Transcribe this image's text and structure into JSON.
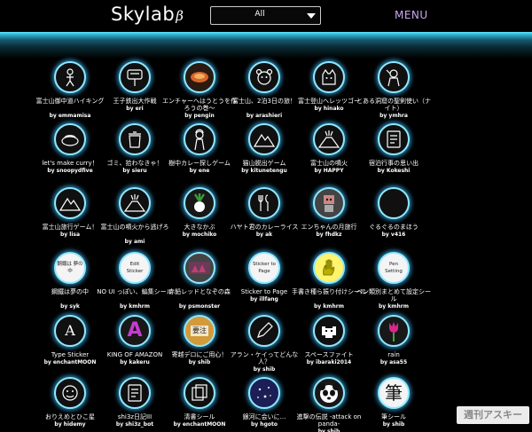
{
  "header": {
    "logo": "Skylab",
    "logo_suffix": "β",
    "filter_value": "All",
    "menu_label": "MENU"
  },
  "stickers": [
    {
      "title": "富士山御中道ハイキング",
      "author": "by emmamisa",
      "icon": "hiker-icon"
    },
    {
      "title": "王子鉄出大作戦",
      "author": "by eri",
      "icon": "sign-icon"
    },
    {
      "title": "エンチャーへはうとうを作ろうの巻～",
      "author": "by pengin",
      "icon": "food-icon"
    },
    {
      "title": "富士山、2泊3日の旅！",
      "author": "by arashieri",
      "icon": "bear-icon"
    },
    {
      "title": "富士登山ヘレッツゴー",
      "author": "by hinako",
      "icon": "cat-icon"
    },
    {
      "title": "とある洞窟の聖剣使い（ナイト）",
      "author": "by ymhra",
      "icon": "knight-icon"
    },
    {
      "title": "let's make curry！",
      "author": "by snoopydfive",
      "icon": "curry-icon"
    },
    {
      "title": "ゴミ、拾わなきゃ！",
      "author": "by sieru",
      "icon": "trash-icon"
    },
    {
      "title": "樹中カレー探しゲーム",
      "author": "by ene",
      "icon": "girl-icon"
    },
    {
      "title": "猫山脱出ゲーム",
      "author": "by kitunetengu",
      "icon": "mountain-icon"
    },
    {
      "title": "富士山の噴火",
      "author": "by HAPPY",
      "icon": "volcano-icon"
    },
    {
      "title": "宿泊行事の思い出",
      "author": "by Kokeshi",
      "icon": "notebook-icon"
    },
    {
      "title": "富士山旅行ゲーム！",
      "author": "by lisa",
      "icon": "mountain-icon"
    },
    {
      "title": "富士山の噴火から逃げろ",
      "author": "by ami",
      "icon": "volcano-icon"
    },
    {
      "title": "大きなかぶ",
      "author": "by mochiko",
      "icon": "turnip-icon"
    },
    {
      "title": "ハヤト君のカレーライス",
      "author": "by ak",
      "icon": "cutlery-icon"
    },
    {
      "title": "エンちゃんの月旅行",
      "author": "by fhdkz",
      "icon": "robot-icon"
    },
    {
      "title": "ぐるぐるのまほう",
      "author": "by v416",
      "icon": "blank-icon"
    },
    {
      "title": "鋼鐵は夢の中",
      "author": "by syk",
      "icon": "text-icon",
      "badge": "鋼鐵は 夢の中"
    },
    {
      "title": "NO UI っぽい、編集シール",
      "author": "by kmhrm",
      "icon": "edit-icon",
      "badge": "Edit Sticker"
    },
    {
      "title": "赤鉛レッドとなぞの森",
      "author": "by psmonster",
      "icon": "forest-icon"
    },
    {
      "title": "Sticker to Page",
      "author": "by illfang",
      "icon": "text-icon",
      "badge": "Sticker to Page"
    },
    {
      "title": "手書き種ら振り付けシール",
      "author": "by kmhrm",
      "icon": "hand-icon"
    },
    {
      "title": "ペン類別まとめて設定シール",
      "author": "by kmhrm",
      "icon": "pen-icon",
      "badge": "Pen Setting"
    },
    {
      "title": "Type Sticker",
      "author": "by enchantMOON",
      "icon": "letter-icon",
      "badge": "A"
    },
    {
      "title": "KING OF AMAZON",
      "author": "by kakeru",
      "icon": "a-logo-icon",
      "badge": "A"
    },
    {
      "title": "寄越デロにご用心！",
      "author": "by shib",
      "icon": "stamp-icon",
      "badge": "要注"
    },
    {
      "title": "アラン・ケイってどんな人？",
      "author": "by shib",
      "icon": "pencil-icon"
    },
    {
      "title": "スペースファイト",
      "author": "by ibaraki2014",
      "icon": "invader-icon"
    },
    {
      "title": "rain",
      "author": "by asa55",
      "icon": "tulip-icon"
    },
    {
      "title": "おりえめとひこ星",
      "author": "by hidemy",
      "icon": "face-icon"
    },
    {
      "title": "shi3z日記III",
      "author": "by shi3z_bot",
      "icon": "notebook-icon"
    },
    {
      "title": "清書シール",
      "author": "by enchantMOON",
      "icon": "pages-icon"
    },
    {
      "title": "銀河に会いに...",
      "author": "by hgoto",
      "icon": "galaxy-icon"
    },
    {
      "title": "進撃の伝説 -attack on panda-",
      "author": "by shib",
      "icon": "panda-icon"
    },
    {
      "title": "筆シール",
      "author": "by shib",
      "icon": "brush-icon",
      "badge": "筆"
    }
  ],
  "watermark": "週刊アスキー",
  "colors": {
    "background": "#000000",
    "glow": "#5ee8ff",
    "circle_border": "#8fe8ff",
    "menu": "#c8a8ee"
  }
}
